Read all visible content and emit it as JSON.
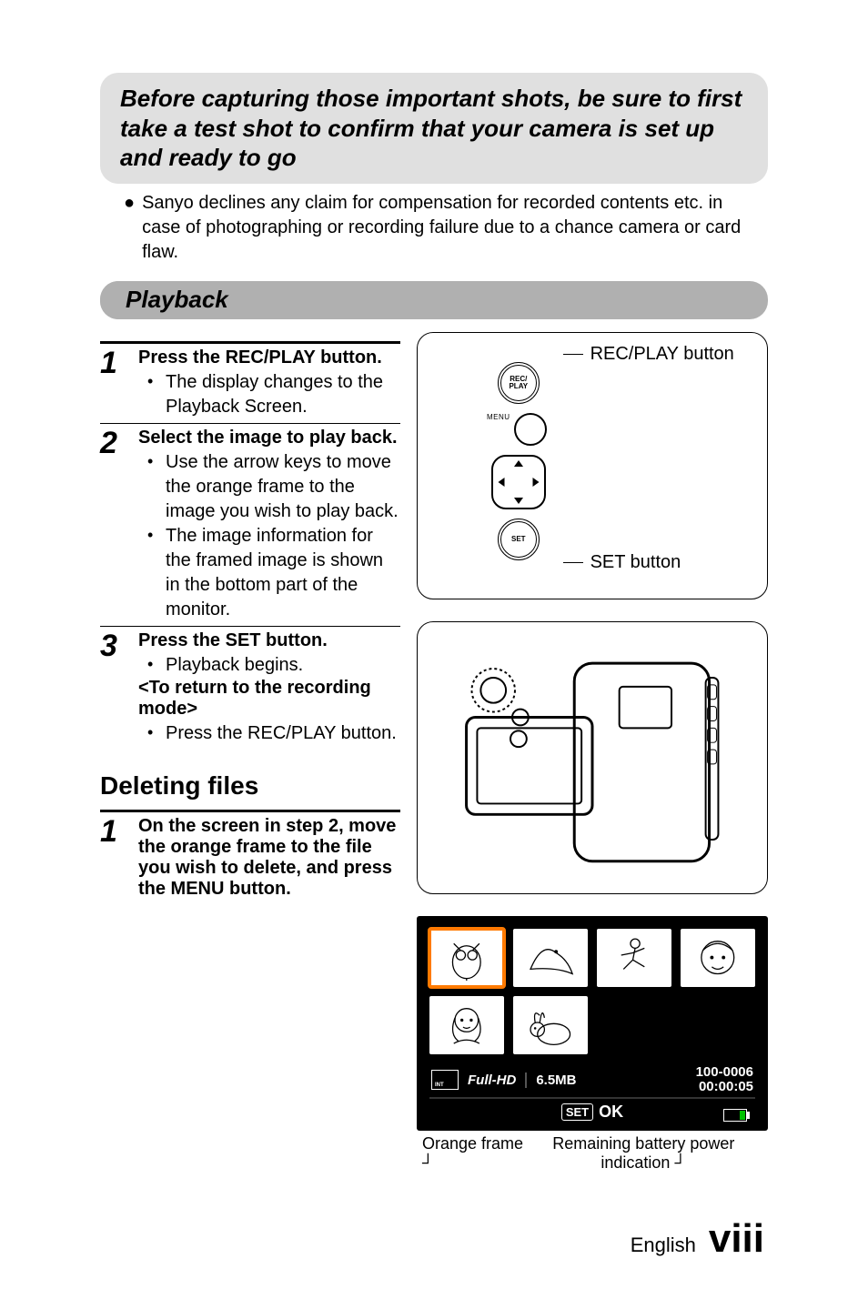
{
  "banner": {
    "text": "Before capturing those important shots, be sure to first take a test shot to confirm that your camera is set up and ready to go"
  },
  "disclaimer": "Sanyo declines any claim for compensation for recorded contents etc. in case of photographing or recording failure due to a chance camera or card flaw.",
  "section_playback": "Playback",
  "steps": {
    "s1": {
      "num": "1",
      "title": "Press the REC/PLAY button.",
      "b1": "The display changes to the Playback Screen."
    },
    "s2": {
      "num": "2",
      "title": "Select the image to play back.",
      "b1": "Use the arrow keys to move the orange frame to the image you wish to play back.",
      "b2": "The image information for the framed image is shown in the bottom part of the monitor."
    },
    "s3": {
      "num": "3",
      "title": "Press the SET button.",
      "b1": "Playback begins.",
      "subbold": "<To return to the recording mode>",
      "b2": "Press the REC/PLAY button."
    }
  },
  "subheading_delete": "Deleting files",
  "delete_step": {
    "num": "1",
    "title": "On the screen in step 2, move the orange frame to the file you wish to delete, and press the MENU button."
  },
  "figure": {
    "rec_play_label": "REC/PLAY button",
    "set_label": "SET button",
    "rec_btn_text": "REC/\nPLAY",
    "menu_small": "MENU",
    "set_btn_text": "SET"
  },
  "screen": {
    "full_hd": "Full-HD",
    "size": "6.5MB",
    "file_no": "100-0006",
    "duration": "00:00:05",
    "set_chip": "SET",
    "ok": "OK"
  },
  "callouts": {
    "orange_frame": "Orange frame",
    "battery": "Remaining battery power indication"
  },
  "footer": {
    "lang": "English",
    "page": "viii"
  }
}
